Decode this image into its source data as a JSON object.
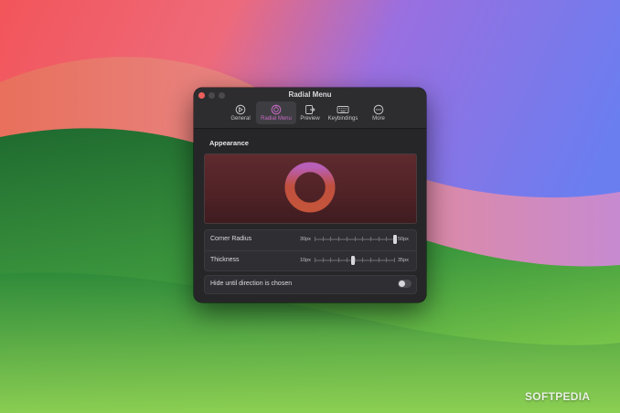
{
  "window": {
    "title": "Radial Menu"
  },
  "toolbar": {
    "items": [
      {
        "label": "General",
        "icon": "gauge-icon"
      },
      {
        "label": "Radial Menu",
        "icon": "radial-menu-icon",
        "selected": true
      },
      {
        "label": "Preview",
        "icon": "preview-icon"
      },
      {
        "label": "Keybindings",
        "icon": "keyboard-icon"
      },
      {
        "label": "More",
        "icon": "ellipsis-icon"
      }
    ]
  },
  "appearance": {
    "section_title": "Appearance"
  },
  "sliders": {
    "corner_radius": {
      "label": "Corner Radius",
      "min_label": "30px",
      "max_label": "50px",
      "min": 30,
      "max": 50,
      "value": 50
    },
    "thickness": {
      "label": "Thickness",
      "min_label": "10px",
      "max_label": "35px",
      "min": 10,
      "max": 35,
      "value": 22
    }
  },
  "toggle": {
    "label": "Hide until direction is chosen",
    "on": false
  },
  "colors": {
    "accent": "#c86bc4",
    "close_button": "#ec5f5b",
    "ring_top": "#b85fb8",
    "ring_bottom": "#c4543a"
  },
  "watermark": {
    "text": "SOFTPEDIA"
  }
}
